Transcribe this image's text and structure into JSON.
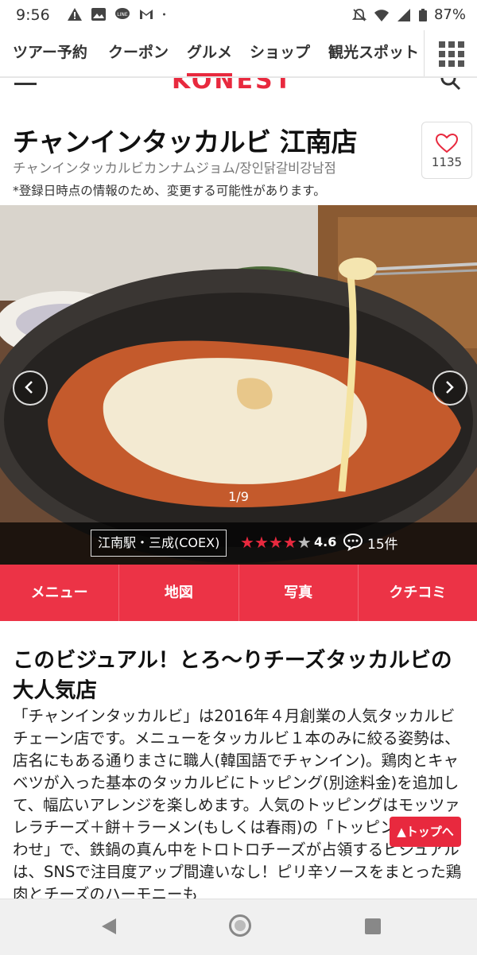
{
  "status_bar": {
    "time": "9:56",
    "battery": "87%",
    "icons": [
      "warning-icon",
      "image-icon",
      "line-icon",
      "gmail-icon",
      "dot-icon",
      "mute-icon",
      "wifi-icon",
      "signal-icon",
      "battery-icon"
    ]
  },
  "nav": {
    "tabs": [
      "ツアー予約",
      "クーポン",
      "グルメ",
      "ショップ",
      "観光スポット"
    ],
    "active_tab": "グルメ",
    "grid_icon": "grid-menu-icon"
  },
  "header": {
    "logo": "KONEST"
  },
  "restaurant": {
    "name": "チャンインタッカルビ 江南店",
    "sub_name": "チャンインタッカルビカンナムジョム/장인닭갈비강남점",
    "notice": "*登録日時点の情報のため、変更する可能性があります。",
    "favorite_count": "1135"
  },
  "gallery": {
    "counter": "1/9",
    "station": "江南駅・三成(COEX)",
    "rating_value": 4.6,
    "rating_text": "4.6",
    "reviews": "15件"
  },
  "menubar": [
    "メニュー",
    "地図",
    "写真",
    "クチコミ"
  ],
  "article": {
    "headline": "このビジュアル！とろ〜りチーズタッカルビの大人気店",
    "body": "「チャンインタッカルビ」は2016年４月創業の人気タッカルビチェーン店です。メニューをタッカルビ１本のみに絞る姿勢は、店名にもある通りまさに職人(韓国語でチャンイン)。鶏肉とキャベツが入った基本のタッカルビにトッピング(別途料金)を追加して、幅広いアレンジを楽しめます。人気のトッピングはモッツァレラチーズ＋餅＋ラーメン(もしくは春雨)の「トッピング盛り合わせ」で、鉄鍋の真ん中をトロトロチーズが占領するビジュアルは、SNSで注目度アップ間違いなし！ピリ辛ソースをまとった鶏肉とチーズのハーモニーも",
    "to_top": "▲トップへ"
  },
  "colors": {
    "accent": "#e8293e",
    "menubar": "#ec3346"
  }
}
